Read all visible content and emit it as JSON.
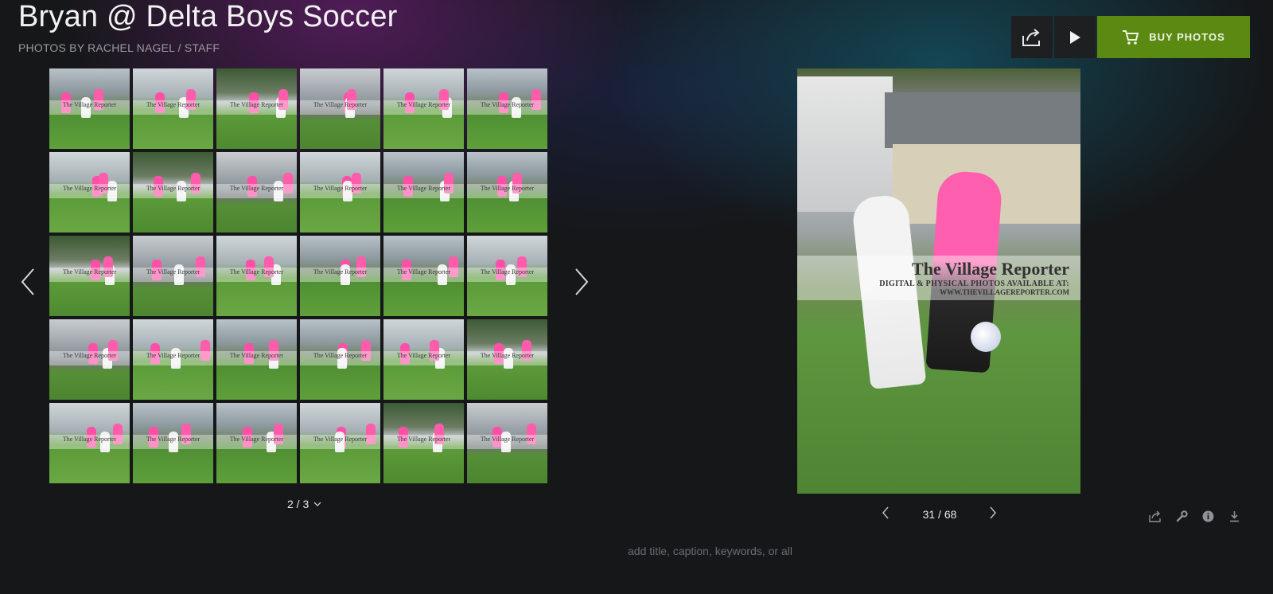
{
  "header": {
    "title": "Bryan @ Delta Boys Soccer",
    "byline": "PHOTOS BY RACHEL NAGEL / STAFF"
  },
  "toolbar": {
    "share_icon": "share-icon",
    "slideshow_icon": "play-icon",
    "buy_label": "BUY PHOTOS",
    "buy_icon": "cart-icon",
    "buy_color": "#5b8a12"
  },
  "gallery": {
    "thumb_watermark": "The Village Reporter",
    "thumb_count": 30,
    "pager": "2 / 3"
  },
  "viewer": {
    "watermark_title": "The Village Reporter",
    "watermark_sub": "DIGITAL & PHYSICAL PHOTOS AVAILABLE AT:",
    "watermark_url": "WWW.THEVILLAGEREPORTER.COM",
    "counter": "31 / 68"
  },
  "tools": [
    "share-icon",
    "wrench-icon",
    "info-icon",
    "download-icon"
  ],
  "caption_placeholder": "add title, caption, keywords, or all"
}
